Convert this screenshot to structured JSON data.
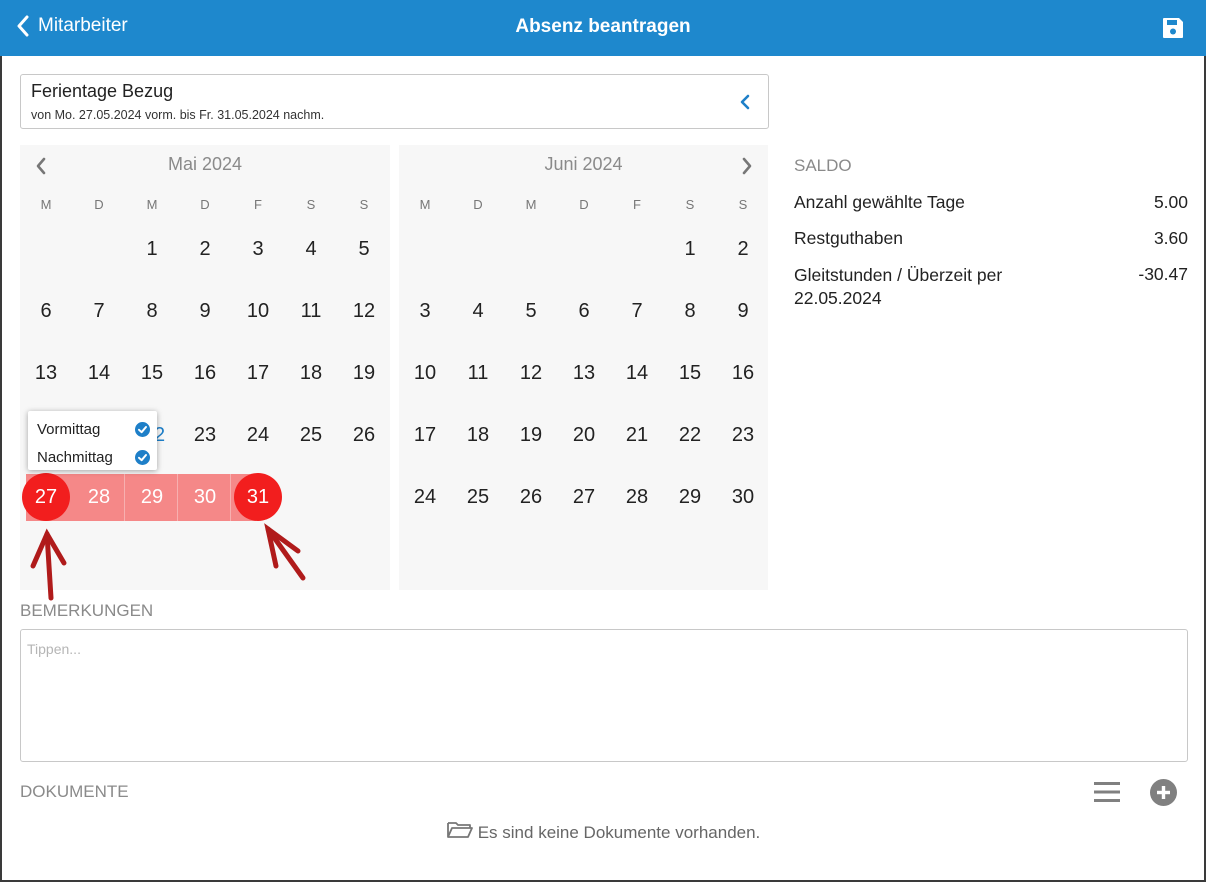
{
  "header": {
    "back_label": "Mitarbeiter",
    "title": "Absenz beantragen",
    "back_icon": "chevron-left-icon",
    "save_icon": "floppy-disk-icon",
    "bg_color": "#1e88cd"
  },
  "absence_type": {
    "title": "Ferientage Bezug",
    "subtitle": "von Mo. 27.05.2024 vorm. bis Fr. 31.05.2024 nachm."
  },
  "calendar": {
    "weekdays": [
      "M",
      "D",
      "M",
      "D",
      "F",
      "S",
      "S"
    ],
    "months": [
      {
        "title": "Mai 2024",
        "first_weekday_index": 2,
        "days": 31
      },
      {
        "title": "Juni 2024",
        "first_weekday_index": 5,
        "days": 30
      }
    ],
    "selection": {
      "start_day": "27",
      "end_day": "31",
      "middle_days": [
        "28",
        "29",
        "30"
      ],
      "circle_color": "#f21e1e",
      "band_color": "#f58888"
    },
    "half_day_popup": {
      "options": [
        {
          "label": "Vormittag",
          "checked": true
        },
        {
          "label": "Nachmittag",
          "checked": true
        }
      ],
      "covered_day_peek": "2"
    }
  },
  "saldo": {
    "heading": "SALDO",
    "rows": [
      {
        "label": "Anzahl gewählte Tage",
        "value": "5.00"
      },
      {
        "label": "Restguthaben",
        "value": "3.60"
      },
      {
        "label": "Gleitstunden / Überzeit per 22.05.2024",
        "value": "-30.47"
      }
    ]
  },
  "remarks": {
    "heading": "BEMERKUNGEN",
    "placeholder": "Tippen...",
    "value": ""
  },
  "documents": {
    "heading": "DOKUMENTE",
    "empty_text": "Es sind keine Dokumente vorhanden.",
    "list_icon": "list-icon",
    "add_icon": "plus-circle-icon",
    "empty_icon": "folder-open-icon"
  },
  "annotation": {
    "arrow_color": "#b01b1b"
  }
}
